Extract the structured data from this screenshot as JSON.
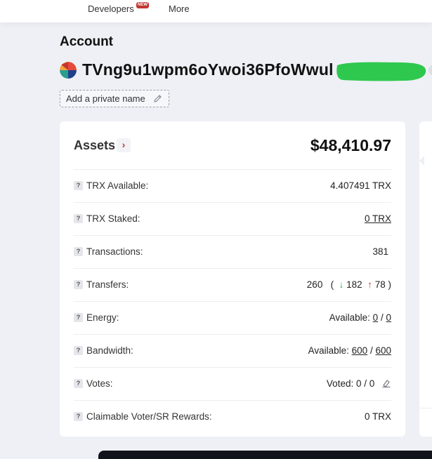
{
  "nav": {
    "developers_label": "Developers",
    "new_badge": "NEW",
    "more_label": "More"
  },
  "page": {
    "title": "Account",
    "address": "TVng9u1wpm6oYwoi36PfoWwul",
    "private_name_button": "Add a private name"
  },
  "assets": {
    "title": "Assets",
    "total": "$48,410.97",
    "rows": {
      "trx_available": {
        "label": "TRX Available:",
        "value": "4.407491 TRX"
      },
      "trx_staked": {
        "label": "TRX Staked:",
        "value": "0 TRX"
      },
      "transactions": {
        "label": "Transactions:",
        "value": "381"
      },
      "transfers": {
        "label": "Transfers:",
        "total": "260",
        "in": "182",
        "out": "78"
      },
      "energy": {
        "label": "Energy:",
        "prefix": "Available:",
        "used": "0",
        "limit": "0"
      },
      "bandwidth": {
        "label": "Bandwidth:",
        "prefix": "Available:",
        "used": "600",
        "limit": "600"
      },
      "votes": {
        "label": "Votes:",
        "value": "Voted: 0 / 0"
      },
      "rewards": {
        "label": "Claimable Voter/SR Rewards:",
        "value": "0 TRX"
      }
    }
  },
  "colors": {
    "accent_red": "#c23631",
    "in_green": "#2aa84a",
    "redaction_green": "#2ec84f"
  }
}
